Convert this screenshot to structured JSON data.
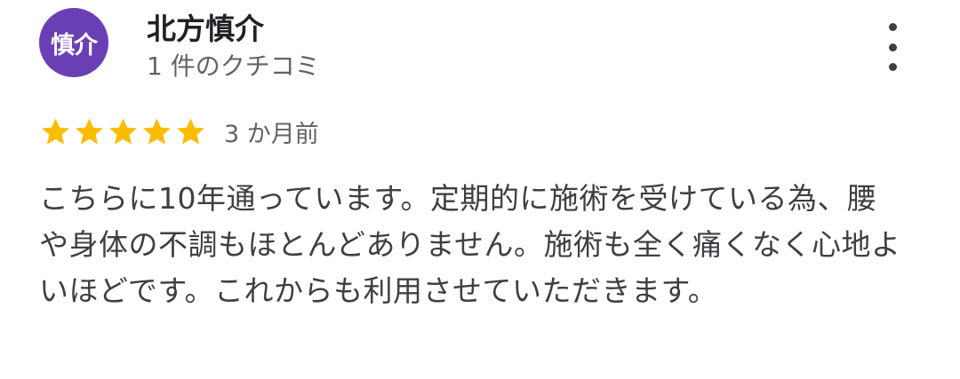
{
  "review": {
    "avatar_text": "慎介",
    "avatar_color": "#6b3fb4",
    "author_name": "北方慎介",
    "author_meta": "1 件のクチコミ",
    "more_icon": "more-vert-icon",
    "rating": 5,
    "max_rating": 5,
    "star_color": "#fbbc04",
    "relative_time": "3 か月前",
    "text": "こちらに10年通っています。定期的に施術を受けている為、腰や身体の不調もほとんどありません。施術も全く痛くなく心地よいほどです。これからも利用させていただきます。"
  }
}
